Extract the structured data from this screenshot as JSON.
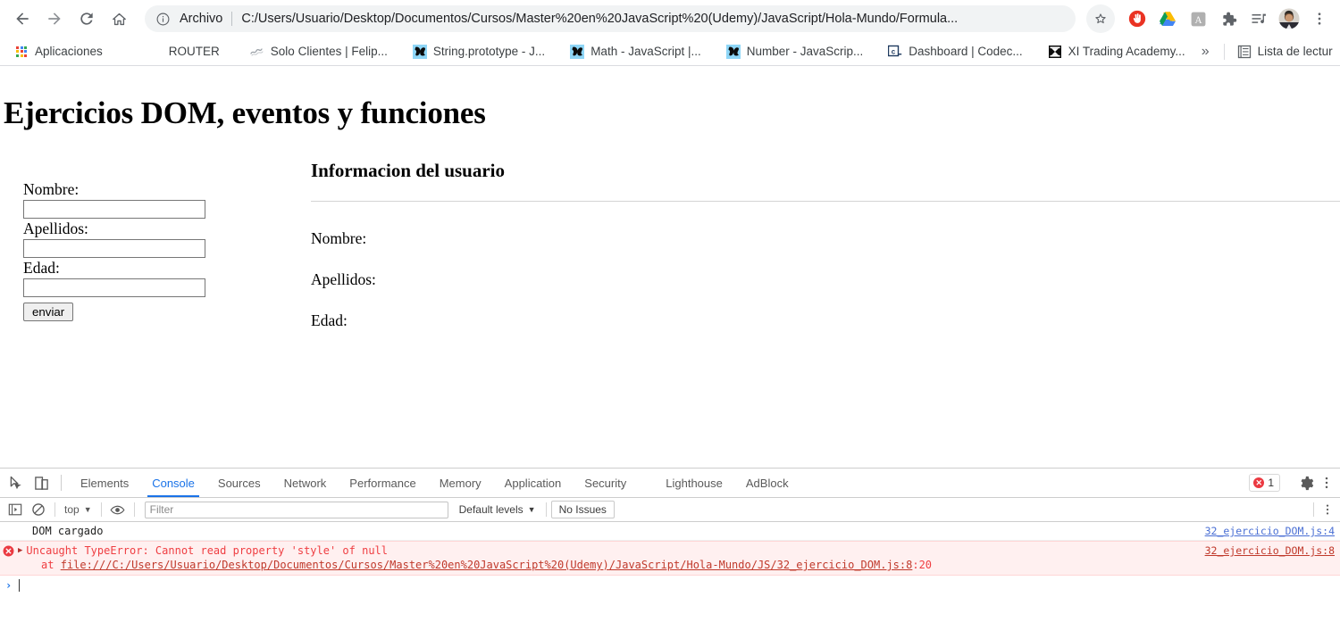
{
  "browser": {
    "nav": {
      "back_label": "Back",
      "forward_label": "Forward",
      "reload_label": "Reload",
      "home_label": "Home"
    },
    "omnibox": {
      "scheme_label": "Archivo",
      "url": "C:/Users/Usuario/Desktop/Documentos/Cursos/Master%20en%20JavaScript%20(Udemy)/JavaScript/Hola-Mundo/Formula...",
      "info_icon": "info-circle-icon"
    },
    "toolbar_icons": [
      {
        "name": "bookmark-star-icon",
        "label": "Marcador"
      },
      {
        "name": "adblock-icon",
        "label": "AdBlock"
      },
      {
        "name": "google-drive-icon",
        "label": "Google Drive"
      },
      {
        "name": "adobe-acrobat-icon",
        "label": "Adobe Acrobat"
      },
      {
        "name": "extensions-puzzle-icon",
        "label": "Extensiones"
      },
      {
        "name": "media-playlist-icon",
        "label": "Lista multimedia"
      },
      {
        "name": "profile-avatar-icon",
        "label": "Perfil"
      },
      {
        "name": "chrome-menu-icon",
        "label": "Menu"
      }
    ],
    "bookmarks": {
      "apps_label": "Aplicaciones",
      "items": [
        {
          "label": "ROUTER",
          "icon": "none"
        },
        {
          "label": "Solo Clientes | Felip...",
          "icon": "script-favicon"
        },
        {
          "label": "String.prototype - J...",
          "icon": "mdn-favicon"
        },
        {
          "label": "Math - JavaScript |...",
          "icon": "mdn-favicon"
        },
        {
          "label": "Number - JavaScrip...",
          "icon": "mdn-favicon"
        },
        {
          "label": "Dashboard | Codec...",
          "icon": "codecademy-favicon"
        },
        {
          "label": "XI Trading Academy...",
          "icon": "trading-favicon"
        }
      ],
      "overflow_label": "»",
      "reading_list_label": "Lista de lectur"
    }
  },
  "page": {
    "title": "Ejercicios DOM, eventos y funciones",
    "form": {
      "fields": [
        {
          "label": "Nombre:",
          "value": "",
          "name": "nombre"
        },
        {
          "label": "Apellidos:",
          "value": "",
          "name": "apellidos"
        },
        {
          "label": "Edad:",
          "value": "",
          "name": "edad"
        }
      ],
      "submit_label": "enviar"
    },
    "info": {
      "heading": "Informacion del usuario",
      "lines": [
        "Nombre:",
        "Apellidos:",
        "Edad:"
      ]
    }
  },
  "devtools": {
    "tool_icons": [
      {
        "name": "inspect-element-icon"
      },
      {
        "name": "device-toolbar-icon"
      }
    ],
    "tabs": [
      {
        "label": "Elements",
        "active": false
      },
      {
        "label": "Console",
        "active": true
      },
      {
        "label": "Sources",
        "active": false
      },
      {
        "label": "Network",
        "active": false
      },
      {
        "label": "Performance",
        "active": false
      },
      {
        "label": "Memory",
        "active": false
      },
      {
        "label": "Application",
        "active": false
      },
      {
        "label": "Security",
        "active": false
      },
      {
        "label": "Lighthouse",
        "active": false
      },
      {
        "label": "AdBlock",
        "active": false
      }
    ],
    "error_badge_count": "1",
    "settings_icon": "gear-icon",
    "more_icon": "more-vertical-icon",
    "console_toolbar": {
      "sidebar_icon": "console-sidebar-icon",
      "clear_icon": "clear-console-icon",
      "context": "top",
      "eye_icon": "live-expression-icon",
      "filter_placeholder": "Filter",
      "filter_value": "",
      "levels_label": "Default levels",
      "issues_label": "No Issues"
    },
    "messages": [
      {
        "type": "log",
        "text": "DOM cargado",
        "source": "32_ejercicio_DOM.js:4"
      },
      {
        "type": "error",
        "text": "Uncaught TypeError: Cannot read property 'style' of null",
        "stack_prefix": "at ",
        "stack_url": "file:///C:/Users/Usuario/Desktop/Documentos/Cursos/Master%20en%20JavaScript%20(Udemy)/JavaScript/Hola-Mundo/JS/32_ejercicio_DOM.js:8",
        "stack_pos": ":20",
        "source": "32_ejercicio_DOM.js:8"
      }
    ],
    "prompt_symbol": "›"
  },
  "colors": {
    "accent_blue": "#1a73e8",
    "error_red": "#ef3e42",
    "error_bg": "#fff0f0",
    "link_blue": "#4a6fd4"
  }
}
